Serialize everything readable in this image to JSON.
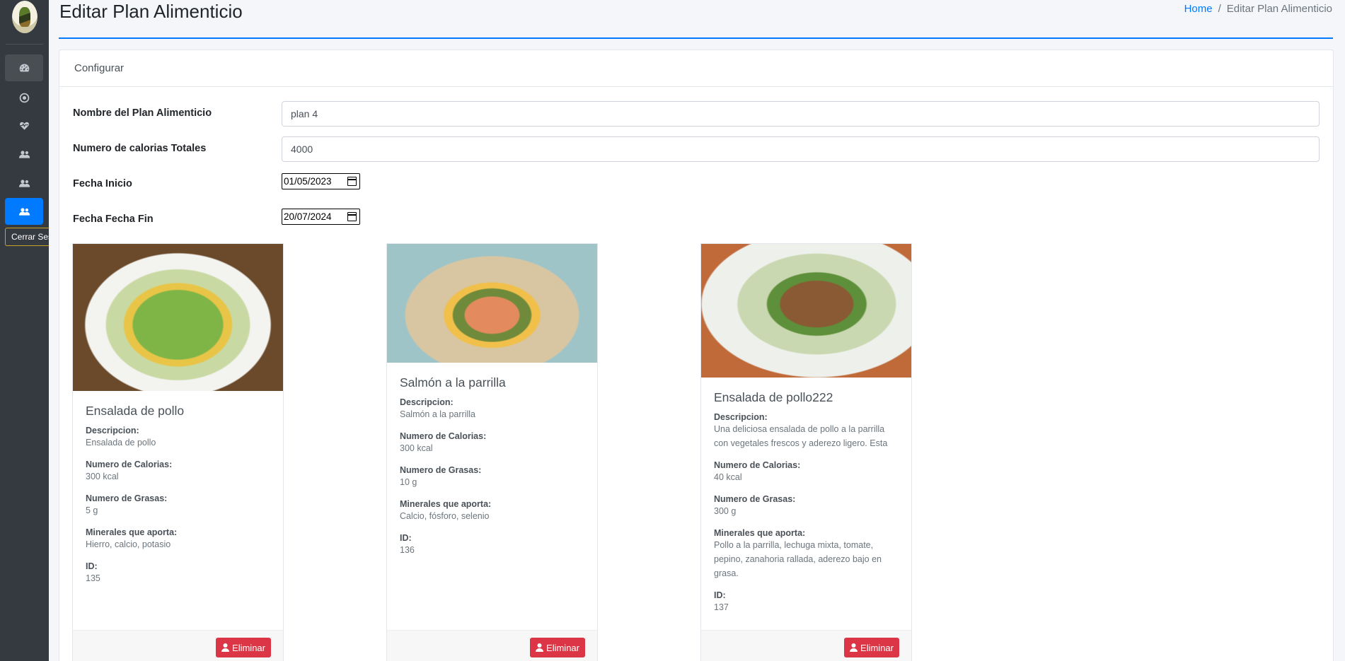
{
  "header": {
    "title": "Editar Plan Alimenticio",
    "breadcrumb_home": "Home",
    "breadcrumb_sep": "/",
    "breadcrumb_current": "Editar Plan Alimenticio"
  },
  "sidebar": {
    "logout_tooltip": "Cerrar Sesión",
    "items": [
      "dashboard-icon",
      "circle-icon",
      "heartbeat-icon",
      "users-icon",
      "users-icon",
      "users-icon"
    ]
  },
  "card": {
    "header": "Configurar"
  },
  "form": {
    "name_label": "Nombre del Plan Alimenticio",
    "name_value": "plan 4",
    "calories_label": "Numero de calorias Totales",
    "calories_value": "4000",
    "start_label": "Fecha Inicio",
    "start_value": "01/05/2023",
    "end_label": "Fecha Fecha Fin",
    "end_value": "20/07/2024"
  },
  "labels": {
    "desc": "Descripcion:",
    "calories": "Numero de Calorias:",
    "fats": "Numero de Grasas:",
    "minerals": "Minerales que aporta:",
    "id": "ID:",
    "delete": "Eliminar"
  },
  "foods": [
    {
      "name": "Ensalada de pollo",
      "description": "Ensalada de pollo",
      "calories": "300 kcal",
      "fats": "5 g",
      "minerals": "Hierro, calcio, potasio",
      "id": "135"
    },
    {
      "name": "Salmón a la parrilla",
      "description": "Salmón a la parrilla",
      "calories": "300 kcal",
      "fats": "10 g",
      "minerals": "Calcio, fósforo, selenio",
      "id": "136"
    },
    {
      "name": "Ensalada de pollo222",
      "description": "Una deliciosa ensalada de pollo a la parrilla con vegetales frescos y aderezo ligero. Esta ensalada",
      "calories": "40 kcal",
      "fats": "300 g",
      "minerals": "Pollo a la parrilla, lechuga mixta, tomate, pepino, zanahoria rallada, aderezo bajo en grasa.",
      "id": "137"
    }
  ],
  "colors": {
    "primary": "#007bff",
    "danger": "#dc3545",
    "sidebar": "#343a40"
  }
}
